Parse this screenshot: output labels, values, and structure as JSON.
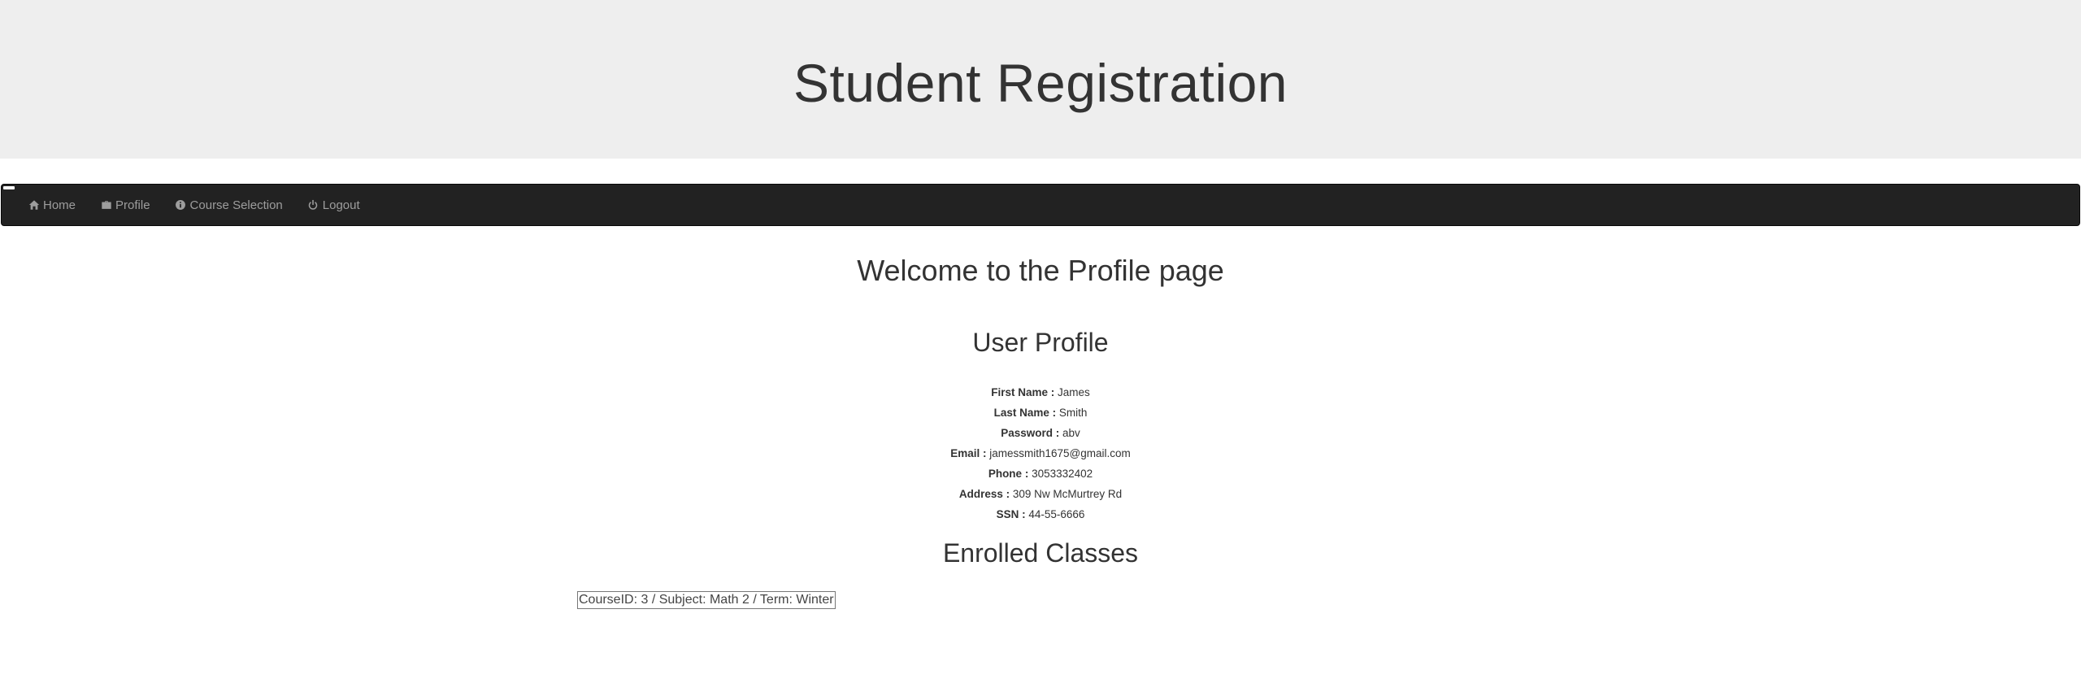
{
  "header": {
    "title": "Student Registration"
  },
  "nav": {
    "items": [
      {
        "label": "Home",
        "icon": "home-icon"
      },
      {
        "label": "Profile",
        "icon": "briefcase-icon"
      },
      {
        "label": "Course Selection",
        "icon": "info-icon"
      },
      {
        "label": "Logout",
        "icon": "power-icon"
      }
    ]
  },
  "main": {
    "welcome": "Welcome to the Profile page",
    "profile_title": "User Profile",
    "profile": [
      {
        "label": "First Name :",
        "value": "James"
      },
      {
        "label": "Last Name :",
        "value": "Smith"
      },
      {
        "label": "Password :",
        "value": "abv"
      },
      {
        "label": "Email :",
        "value": "jamessmith1675@gmail.com"
      },
      {
        "label": "Phone :",
        "value": "3053332402"
      },
      {
        "label": "Address :",
        "value": "309 Nw McMurtrey Rd"
      },
      {
        "label": "SSN :",
        "value": "44-55-6666"
      }
    ],
    "enrolled_title": "Enrolled Classes",
    "enrolled": [
      {
        "text": "CourseID: 3 / Subject: Math 2 / Term: Winter"
      }
    ]
  },
  "colors": {
    "header_bg": "#eeeeee",
    "navbar_bg": "#222222",
    "nav_text": "#9d9d9d",
    "text": "#333333"
  }
}
